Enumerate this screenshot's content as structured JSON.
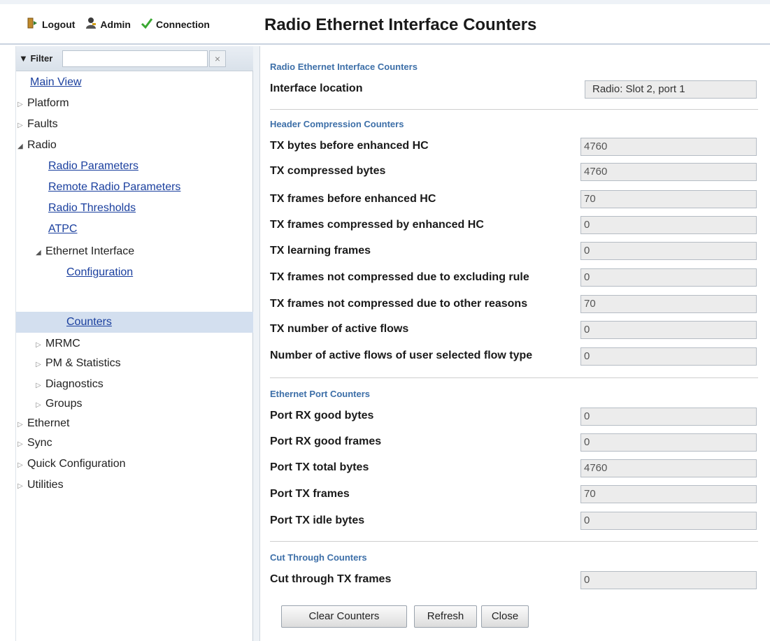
{
  "topbar": {
    "logout_label": "Logout",
    "admin_label": "Admin",
    "connection_label": "Connection",
    "title": "Radio Ethernet Interface Counters"
  },
  "sidebar": {
    "filter_label": "Filter",
    "filter_value": "",
    "filter_clear_glyph": "×",
    "tree": [
      {
        "label": "Main View",
        "type": "link"
      },
      {
        "label": "Platform",
        "type": "collapsed"
      },
      {
        "label": "Faults",
        "type": "collapsed"
      },
      {
        "label": "Radio",
        "type": "expanded"
      },
      {
        "label": "Radio Parameters",
        "type": "link"
      },
      {
        "label": "Remote Radio Parameters",
        "type": "link"
      },
      {
        "label": "Radio Thresholds",
        "type": "link"
      },
      {
        "label": "ATPC",
        "type": "link"
      },
      {
        "label": "Ethernet Interface",
        "type": "expanded"
      },
      {
        "label": "Configuration",
        "type": "link"
      },
      {
        "label": "Counters",
        "type": "link",
        "selected": true
      },
      {
        "label": "MRMC",
        "type": "collapsed"
      },
      {
        "label": "PM & Statistics",
        "type": "collapsed"
      },
      {
        "label": "Diagnostics",
        "type": "collapsed"
      },
      {
        "label": "Groups",
        "type": "collapsed"
      },
      {
        "label": "Ethernet",
        "type": "collapsed"
      },
      {
        "label": "Sync",
        "type": "collapsed"
      },
      {
        "label": "Quick Configuration",
        "type": "collapsed"
      },
      {
        "label": "Utilities",
        "type": "collapsed"
      }
    ]
  },
  "main": {
    "section1": {
      "title": "Radio Ethernet Interface Counters",
      "interface_location_label": "Interface location",
      "interface_location_value": "Radio: Slot 2, port 1"
    },
    "section2": {
      "title": "Header Compression Counters",
      "fields": [
        {
          "label": "TX bytes before enhanced HC",
          "value": "4760"
        },
        {
          "label": "TX compressed bytes",
          "value": "4760"
        },
        {
          "label": "TX frames before enhanced HC",
          "value": "70"
        },
        {
          "label": "TX frames compressed by enhanced HC",
          "value": "0"
        },
        {
          "label": "TX learning frames",
          "value": "0"
        },
        {
          "label": "TX frames not compressed due to excluding rule",
          "value": "0"
        },
        {
          "label": "TX frames not compressed due to other reasons",
          "value": "70"
        },
        {
          "label": "TX number of active flows",
          "value": "0"
        },
        {
          "label": "Number of active flows of user selected flow type",
          "value": "0"
        }
      ]
    },
    "section3": {
      "title": "Ethernet Port Counters",
      "fields": [
        {
          "label": "Port RX good bytes",
          "value": "0"
        },
        {
          "label": "Port RX good frames",
          "value": "0"
        },
        {
          "label": "Port TX total bytes",
          "value": "4760"
        },
        {
          "label": "Port TX frames",
          "value": "70"
        },
        {
          "label": "Port TX idle bytes",
          "value": "0"
        }
      ]
    },
    "section4": {
      "title": "Cut Through Counters",
      "fields": [
        {
          "label": "Cut through TX frames",
          "value": "0"
        }
      ]
    },
    "buttons": {
      "clear_label": "Clear Counters",
      "refresh_label": "Refresh",
      "close_label": "Close"
    }
  },
  "colors": {
    "link": "#1a3f9e",
    "section_title": "#3d6fa8",
    "selected_row": "#d3dfef"
  }
}
